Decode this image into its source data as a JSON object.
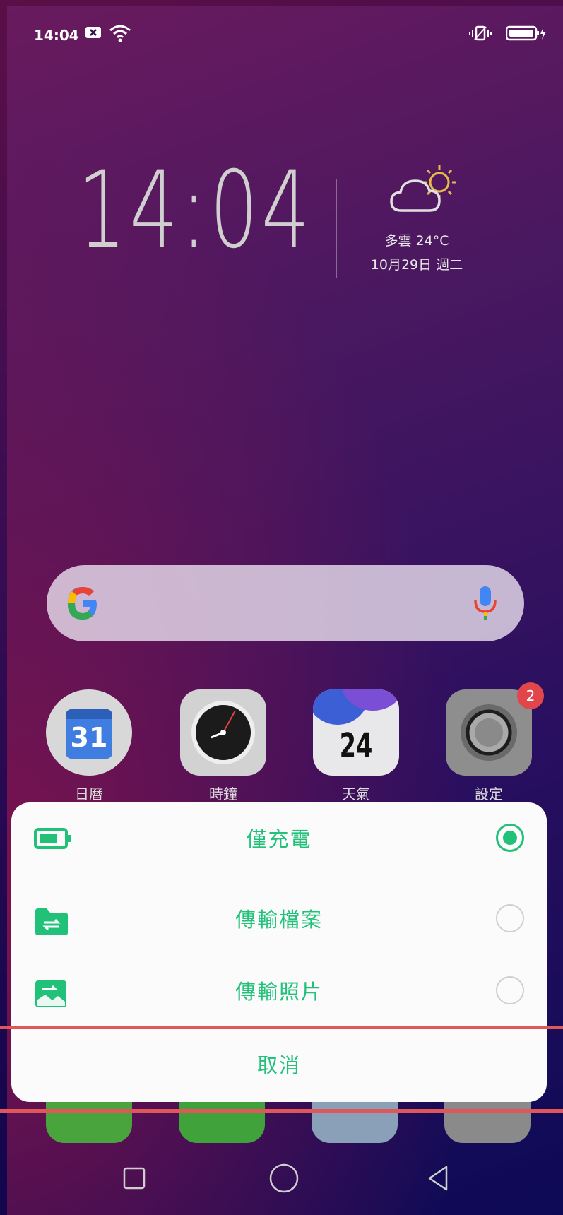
{
  "status_bar": {
    "time": "14:04",
    "icons": [
      "close-box-icon",
      "wifi-icon",
      "vibrate-icon",
      "battery-charging-icon"
    ]
  },
  "clock_widget": {
    "time": "14:04",
    "weather": "多雲 24°C",
    "date": "10月29日 週二",
    "weather_icon": "partly-cloudy-icon"
  },
  "search_bar": {
    "logo": "google-logo",
    "mic": "mic-icon"
  },
  "apps": [
    {
      "label": "日曆",
      "icon": "calendar-icon",
      "text": "31"
    },
    {
      "label": "時鐘",
      "icon": "clock-icon"
    },
    {
      "label": "天氣",
      "icon": "weather-icon",
      "text": "24"
    },
    {
      "label": "設定",
      "icon": "settings-icon",
      "badge": "2"
    }
  ],
  "usb_sheet": {
    "options": [
      {
        "label": "僅充電",
        "icon": "battery-icon",
        "selected": true
      },
      {
        "label": "傳輸檔案",
        "icon": "folder-transfer-icon",
        "selected": false
      },
      {
        "label": "傳輸照片",
        "icon": "photo-icon",
        "selected": false
      }
    ],
    "cancel": "取消"
  },
  "nav_bar": [
    "recents-icon",
    "home-icon",
    "back-icon"
  ],
  "colors": {
    "accent": "#21c17a",
    "highlight": "#e0575a"
  }
}
